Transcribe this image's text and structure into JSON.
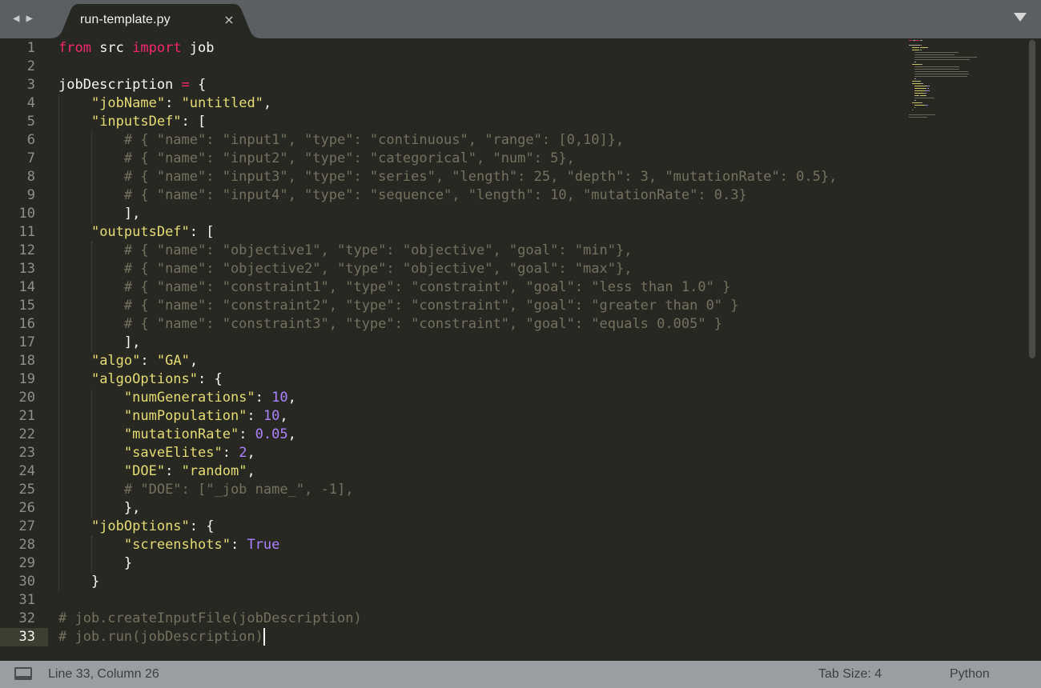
{
  "tab": {
    "title": "run-template.py",
    "close_glyph": "×"
  },
  "nav": {
    "back_glyph": "◀",
    "forward_glyph": "▶"
  },
  "editor": {
    "current_line": 33,
    "lines": [
      [
        [
          "kw",
          "from"
        ],
        [
          "plain",
          " src "
        ],
        [
          "kw",
          "import"
        ],
        [
          "plain",
          " job"
        ]
      ],
      [],
      [
        [
          "plain",
          "jobDescription "
        ],
        [
          "op",
          "="
        ],
        [
          "plain",
          " {"
        ]
      ],
      [
        [
          "plain",
          "    "
        ],
        [
          "str",
          "\"jobName\""
        ],
        [
          "plain",
          ": "
        ],
        [
          "str",
          "\"untitled\""
        ],
        [
          "plain",
          ","
        ]
      ],
      [
        [
          "plain",
          "    "
        ],
        [
          "str",
          "\"inputsDef\""
        ],
        [
          "plain",
          ": ["
        ]
      ],
      [
        [
          "plain",
          "        "
        ],
        [
          "cmt",
          "# { \"name\": \"input1\", \"type\": \"continuous\", \"range\": [0,10]},"
        ]
      ],
      [
        [
          "plain",
          "        "
        ],
        [
          "cmt",
          "# { \"name\": \"input2\", \"type\": \"categorical\", \"num\": 5},"
        ]
      ],
      [
        [
          "plain",
          "        "
        ],
        [
          "cmt",
          "# { \"name\": \"input3\", \"type\": \"series\", \"length\": 25, \"depth\": 3, \"mutationRate\": 0.5},"
        ]
      ],
      [
        [
          "plain",
          "        "
        ],
        [
          "cmt",
          "# { \"name\": \"input4\", \"type\": \"sequence\", \"length\": 10, \"mutationRate\": 0.3}"
        ]
      ],
      [
        [
          "plain",
          "        ],"
        ]
      ],
      [
        [
          "plain",
          "    "
        ],
        [
          "str",
          "\"outputsDef\""
        ],
        [
          "plain",
          ": ["
        ]
      ],
      [
        [
          "plain",
          "        "
        ],
        [
          "cmt",
          "# { \"name\": \"objective1\", \"type\": \"objective\", \"goal\": \"min\"},"
        ]
      ],
      [
        [
          "plain",
          "        "
        ],
        [
          "cmt",
          "# { \"name\": \"objective2\", \"type\": \"objective\", \"goal\": \"max\"},"
        ]
      ],
      [
        [
          "plain",
          "        "
        ],
        [
          "cmt",
          "# { \"name\": \"constraint1\", \"type\": \"constraint\", \"goal\": \"less than 1.0\" }"
        ]
      ],
      [
        [
          "plain",
          "        "
        ],
        [
          "cmt",
          "# { \"name\": \"constraint2\", \"type\": \"constraint\", \"goal\": \"greater than 0\" }"
        ]
      ],
      [
        [
          "plain",
          "        "
        ],
        [
          "cmt",
          "# { \"name\": \"constraint3\", \"type\": \"constraint\", \"goal\": \"equals 0.005\" }"
        ]
      ],
      [
        [
          "plain",
          "        ],"
        ]
      ],
      [
        [
          "plain",
          "    "
        ],
        [
          "str",
          "\"algo\""
        ],
        [
          "plain",
          ": "
        ],
        [
          "str",
          "\"GA\""
        ],
        [
          "plain",
          ","
        ]
      ],
      [
        [
          "plain",
          "    "
        ],
        [
          "str",
          "\"algoOptions\""
        ],
        [
          "plain",
          ": {"
        ]
      ],
      [
        [
          "plain",
          "        "
        ],
        [
          "str",
          "\"numGenerations\""
        ],
        [
          "plain",
          ": "
        ],
        [
          "num",
          "10"
        ],
        [
          "plain",
          ","
        ]
      ],
      [
        [
          "plain",
          "        "
        ],
        [
          "str",
          "\"numPopulation\""
        ],
        [
          "plain",
          ": "
        ],
        [
          "num",
          "10"
        ],
        [
          "plain",
          ","
        ]
      ],
      [
        [
          "plain",
          "        "
        ],
        [
          "str",
          "\"mutationRate\""
        ],
        [
          "plain",
          ": "
        ],
        [
          "num",
          "0.05"
        ],
        [
          "plain",
          ","
        ]
      ],
      [
        [
          "plain",
          "        "
        ],
        [
          "str",
          "\"saveElites\""
        ],
        [
          "plain",
          ": "
        ],
        [
          "num",
          "2"
        ],
        [
          "plain",
          ","
        ]
      ],
      [
        [
          "plain",
          "        "
        ],
        [
          "str",
          "\"DOE\""
        ],
        [
          "plain",
          ": "
        ],
        [
          "str",
          "\"random\""
        ],
        [
          "plain",
          ","
        ]
      ],
      [
        [
          "plain",
          "        "
        ],
        [
          "cmt",
          "# \"DOE\": [\"_job name_\", -1],"
        ]
      ],
      [
        [
          "plain",
          "        },"
        ]
      ],
      [
        [
          "plain",
          "    "
        ],
        [
          "str",
          "\"jobOptions\""
        ],
        [
          "plain",
          ": {"
        ]
      ],
      [
        [
          "plain",
          "        "
        ],
        [
          "str",
          "\"screenshots\""
        ],
        [
          "plain",
          ": "
        ],
        [
          "cst",
          "True"
        ]
      ],
      [
        [
          "plain",
          "        }"
        ]
      ],
      [
        [
          "plain",
          "    }"
        ]
      ],
      [],
      [
        [
          "cmt",
          "# job.createInputFile(jobDescription)"
        ]
      ],
      [
        [
          "cmt",
          "# job.run(jobDescription)"
        ]
      ]
    ]
  },
  "status": {
    "position": "Line 33, Column 26",
    "tab_size": "Tab Size: 4",
    "language": "Python"
  },
  "colors": {
    "background": "#272822",
    "keyword": "#f92672",
    "string": "#e6db74",
    "number": "#ae81ff",
    "comment": "#75715e",
    "text": "#f8f8f2"
  },
  "icons": [
    "back-arrow-icon",
    "forward-arrow-icon",
    "close-icon",
    "tab-menu-icon",
    "panel-toggle-icon"
  ]
}
